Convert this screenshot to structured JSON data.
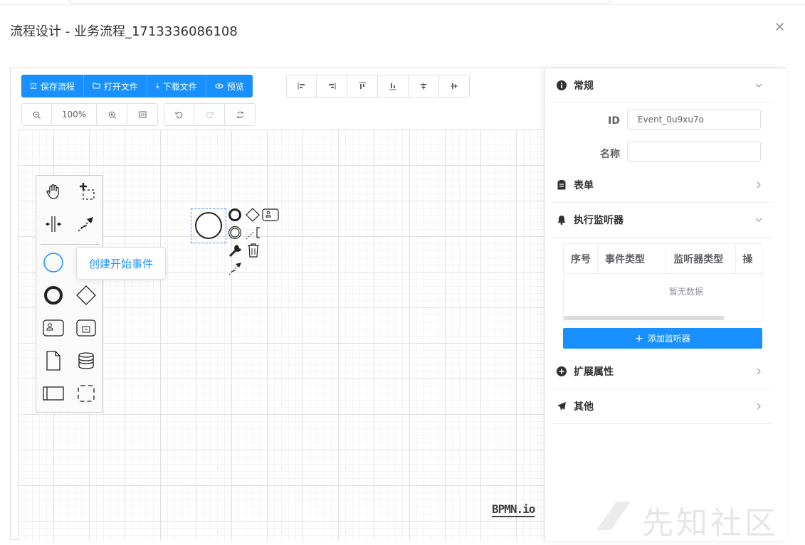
{
  "dialog": {
    "title": "流程设计 - 业务流程_1713336086108",
    "close_icon": "close-icon"
  },
  "toolbar": {
    "actions": [
      {
        "icon": "edit-icon",
        "label": "保存流程"
      },
      {
        "icon": "folder-open-icon",
        "label": "打开文件"
      },
      {
        "icon": "download-icon",
        "label": "下载文件"
      },
      {
        "icon": "eye-icon",
        "label": "预览"
      }
    ],
    "align_icons": [
      "align-left-icon",
      "align-right-icon",
      "align-top-icon",
      "align-bottom-icon",
      "align-center-vertical-icon",
      "align-middle-horizontal-icon"
    ],
    "zoom": {
      "zoom_out_icon": "zoom-out-icon",
      "level": "100%",
      "zoom_in_icon": "zoom-in-icon",
      "fit_icon": "fit-view-icon"
    },
    "history_icons": [
      "undo-icon",
      "redo-icon",
      "refresh-icon"
    ]
  },
  "palette": {
    "tools": [
      "hand-tool-icon",
      "lasso-tool-icon",
      "space-tool-icon",
      "global-connect-tool-icon"
    ],
    "elements": [
      "start-event-icon",
      "intermediate-event-icon",
      "end-event-icon",
      "gateway-icon",
      "user-task-icon",
      "sub-process-icon",
      "data-object-icon",
      "data-store-icon",
      "participant-icon",
      "group-icon"
    ],
    "tooltip": "创建开始事件"
  },
  "canvas": {
    "watermark_logo": "BPMN.io"
  },
  "panel": {
    "sections": [
      {
        "icon": "info-icon",
        "title": "常规",
        "expanded": true
      },
      {
        "icon": "clipboard-icon",
        "title": "表单",
        "expanded": false
      },
      {
        "icon": "bell-icon",
        "title": "执行监听器",
        "expanded": true
      },
      {
        "icon": "plus-circle-icon",
        "title": "扩展属性",
        "expanded": false
      },
      {
        "icon": "send-icon",
        "title": "其他",
        "expanded": false
      }
    ],
    "general": {
      "id_label": "ID",
      "id_value": "Event_0u9xu7o",
      "name_label": "名称",
      "name_value": ""
    },
    "listeners": {
      "columns": [
        "序号",
        "事件类型",
        "监听器类型",
        "操"
      ],
      "empty_text": "暂无数据",
      "add_button": "添加监听器"
    }
  },
  "watermark": "先知社区",
  "colors": {
    "primary": "#1890ff",
    "border": "#dcdfe6"
  }
}
